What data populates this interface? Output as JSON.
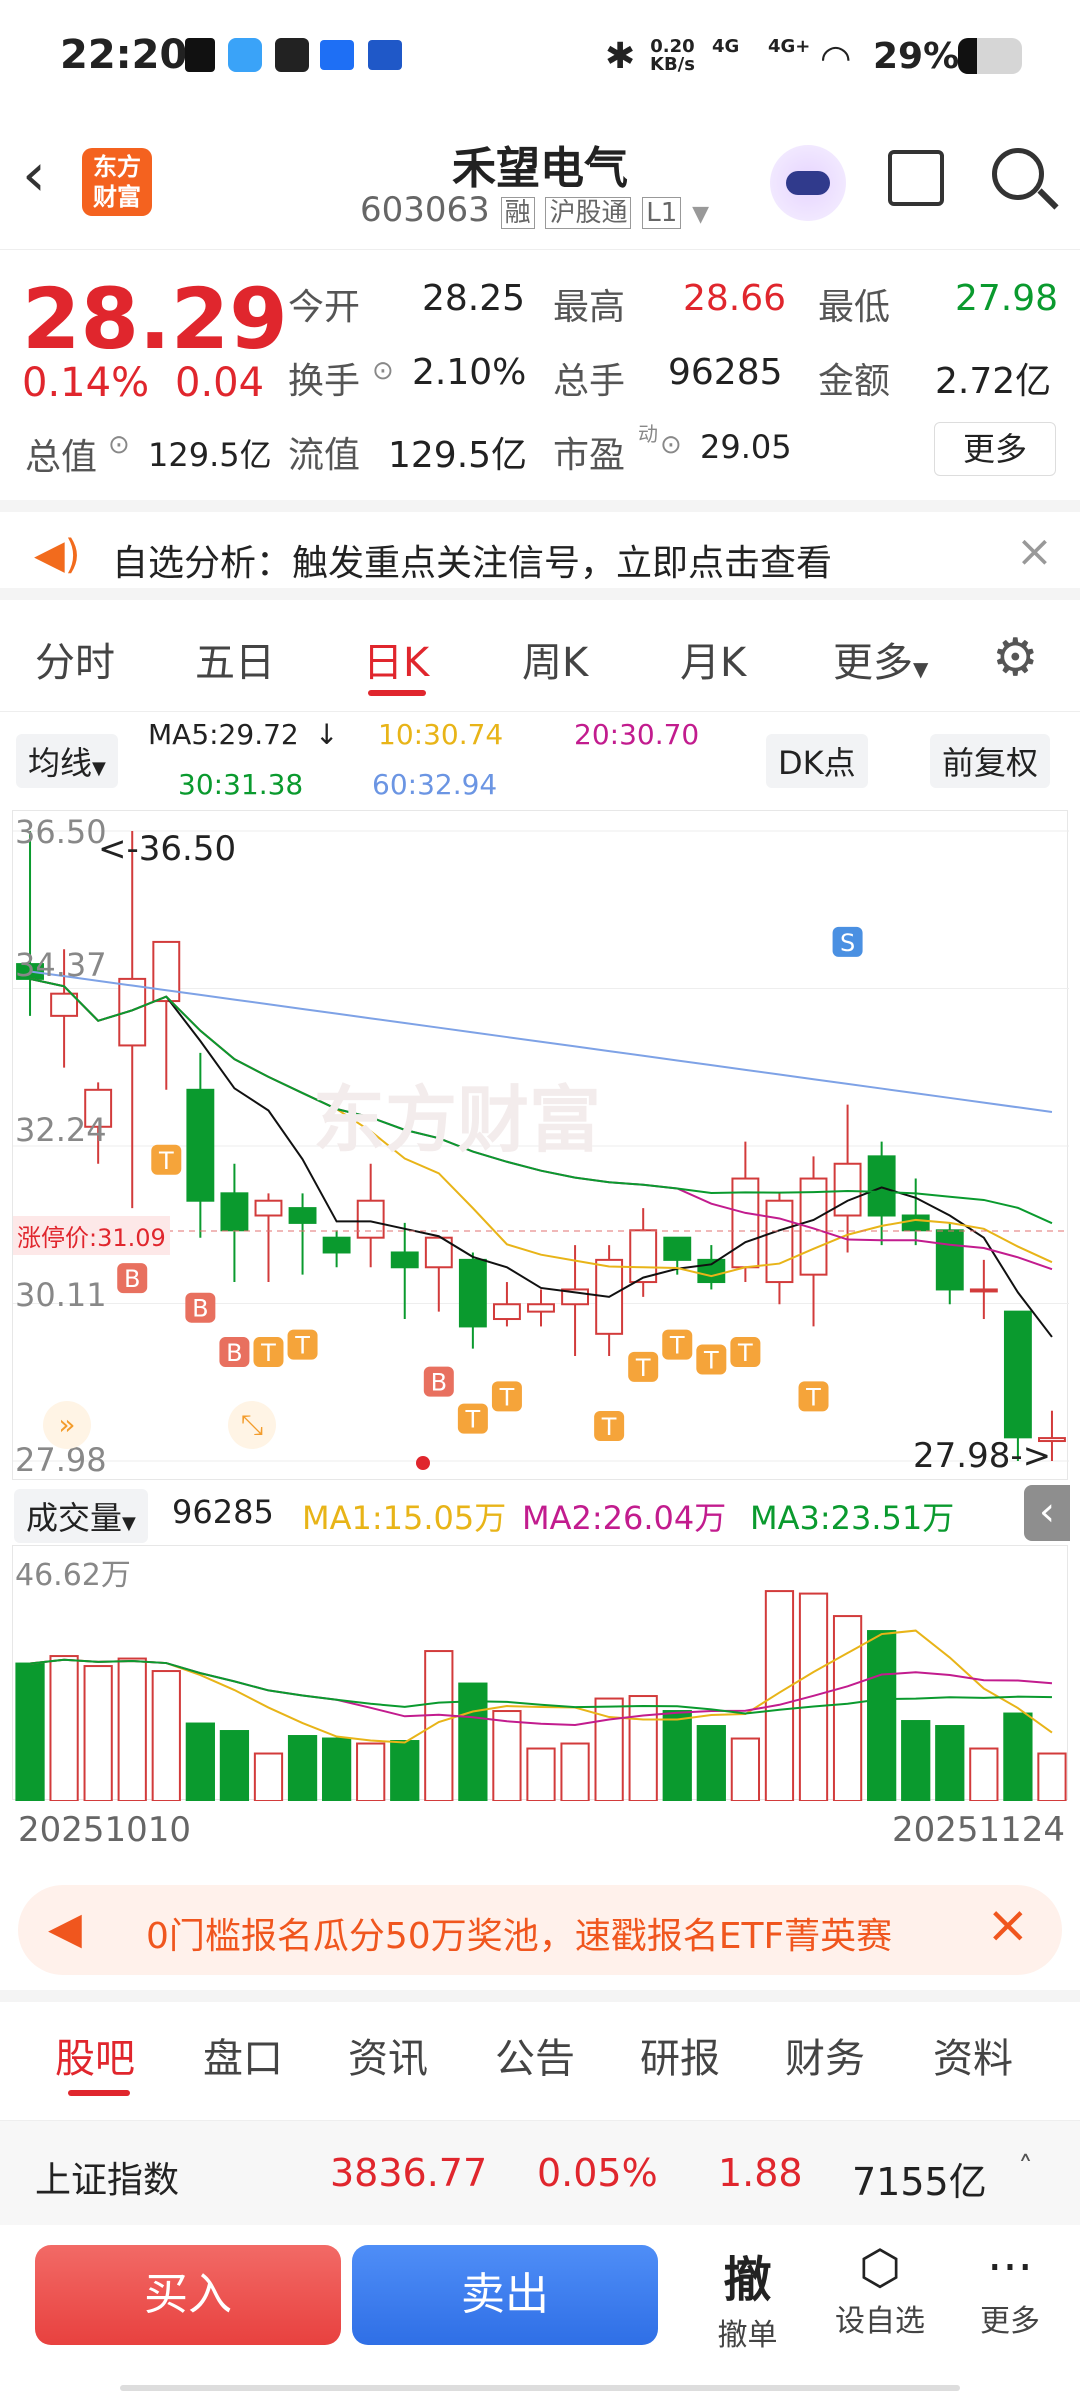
{
  "status": {
    "time": "22:20",
    "net_speed": "0.20",
    "net_unit": "KB/s",
    "signal1": "4G",
    "signal2": "4G+",
    "battery": "29%"
  },
  "header": {
    "logo_line1": "东方",
    "logo_line2": "财富",
    "name": "禾望电气",
    "code": "603063",
    "tags": [
      "融",
      "沪股通",
      "L1"
    ]
  },
  "quote": {
    "price": "28.29",
    "pct": "0.14%",
    "chg": "0.04",
    "open_label": "今开",
    "open": "28.25",
    "high_label": "最高",
    "high": "28.66",
    "low_label": "最低",
    "low": "27.98",
    "turnover_label": "换手",
    "turnover": "2.10%",
    "vol_label": "总手",
    "vol": "96285",
    "amount_label": "金额",
    "amount": "2.72亿",
    "mcap_label": "总值",
    "mcap": "129.5亿",
    "float_label": "流值",
    "float": "129.5亿",
    "pe_label": "市盈",
    "pe_sup": "动",
    "pe": "29.05",
    "more": "更多"
  },
  "notice": {
    "text": "自选分析：触发重点关注信号，立即点击查看"
  },
  "tabs": [
    "分时",
    "五日",
    "日K",
    "周K",
    "月K",
    "更多"
  ],
  "ma_bar": {
    "label": "均线",
    "ma5": "MA5:29.72",
    "ma10": "10:30.74",
    "ma20": "20:30.70",
    "ma30": "30:31.38",
    "ma60": "60:32.94",
    "dk": "DK点",
    "adj": "前复权"
  },
  "kchart": {
    "y_labels": [
      "36.50",
      "34.37",
      "32.24",
      "30.11",
      "27.98"
    ],
    "max_marker": "<-36.50",
    "min_marker": "27.98->",
    "limit_label": "涨停价:31.09",
    "marker_S": "S",
    "marker_B": "B",
    "marker_T": "T",
    "watermark": "东方财富"
  },
  "vol_bar": {
    "label": "成交量",
    "value": "96285",
    "ma1": "MA1:15.05万",
    "ma2": "MA2:26.04万",
    "ma3": "MA3:23.51万",
    "y_max": "46.62万"
  },
  "dates": {
    "start": "20251010",
    "end": "20251124"
  },
  "promo": {
    "text": "0门槛报名瓜分50万奖池，速戳报名ETF菁英赛"
  },
  "bottom_tabs": [
    "股吧",
    "盘口",
    "资讯",
    "公告",
    "研报",
    "财务",
    "资料"
  ],
  "index": {
    "name": "上证指数",
    "value": "3836.77",
    "pct": "0.05%",
    "chg": "1.88",
    "amount": "7155亿"
  },
  "actions": {
    "buy": "买入",
    "sell": "卖出",
    "cancel_icon": "撤",
    "cancel": "撤单",
    "fav": "设自选",
    "more": "更多"
  },
  "chart_data": {
    "type": "candlestick",
    "x_range": [
      "20251010",
      "20251124"
    ],
    "ylim": [
      27.98,
      36.5
    ],
    "candles": [
      {
        "o": 34.7,
        "h": 36.5,
        "l": 34.0,
        "c": 34.5
      },
      {
        "o": 34.0,
        "h": 34.9,
        "l": 33.3,
        "c": 34.3
      },
      {
        "o": 32.5,
        "h": 33.1,
        "l": 32.0,
        "c": 33.0
      },
      {
        "o": 33.6,
        "h": 36.5,
        "l": 31.4,
        "c": 34.5
      },
      {
        "o": 34.2,
        "h": 34.8,
        "l": 33.0,
        "c": 35.0
      },
      {
        "o": 33.0,
        "h": 33.5,
        "l": 31.0,
        "c": 31.5
      },
      {
        "o": 31.6,
        "h": 32.0,
        "l": 30.4,
        "c": 31.1
      },
      {
        "o": 31.3,
        "h": 31.6,
        "l": 30.4,
        "c": 31.5
      },
      {
        "o": 31.4,
        "h": 31.6,
        "l": 30.5,
        "c": 31.2
      },
      {
        "o": 31.0,
        "h": 31.1,
        "l": 30.6,
        "c": 30.8
      },
      {
        "o": 31.0,
        "h": 32.0,
        "l": 30.6,
        "c": 31.5
      },
      {
        "o": 30.8,
        "h": 31.2,
        "l": 29.9,
        "c": 30.6
      },
      {
        "o": 30.6,
        "h": 31.0,
        "l": 30.0,
        "c": 31.0
      },
      {
        "o": 30.7,
        "h": 30.8,
        "l": 29.5,
        "c": 29.8
      },
      {
        "o": 29.9,
        "h": 30.4,
        "l": 29.8,
        "c": 30.1
      },
      {
        "o": 30.0,
        "h": 30.3,
        "l": 29.8,
        "c": 30.1
      },
      {
        "o": 30.1,
        "h": 30.9,
        "l": 29.4,
        "c": 30.3
      },
      {
        "o": 29.7,
        "h": 30.9,
        "l": 29.4,
        "c": 30.7
      },
      {
        "o": 30.4,
        "h": 31.4,
        "l": 30.2,
        "c": 31.1
      },
      {
        "o": 31.0,
        "h": 31.0,
        "l": 30.5,
        "c": 30.7
      },
      {
        "o": 30.7,
        "h": 30.9,
        "l": 30.3,
        "c": 30.4
      },
      {
        "o": 30.6,
        "h": 32.3,
        "l": 30.4,
        "c": 31.8
      },
      {
        "o": 30.4,
        "h": 31.6,
        "l": 30.1,
        "c": 31.5
      },
      {
        "o": 30.5,
        "h": 32.1,
        "l": 29.8,
        "c": 31.8
      },
      {
        "o": 31.3,
        "h": 32.8,
        "l": 30.8,
        "c": 32.0
      },
      {
        "o": 32.1,
        "h": 32.3,
        "l": 30.9,
        "c": 31.3
      },
      {
        "o": 31.3,
        "h": 31.8,
        "l": 30.9,
        "c": 31.1
      },
      {
        "o": 31.1,
        "h": 31.2,
        "l": 30.1,
        "c": 30.3
      },
      {
        "o": 30.3,
        "h": 30.7,
        "l": 29.9,
        "c": 30.3
      },
      {
        "o": 30.0,
        "h": 30.0,
        "l": 27.98,
        "c": 28.3
      },
      {
        "o": 28.25,
        "h": 28.66,
        "l": 27.98,
        "c": 28.29
      }
    ],
    "volume": [
      0.55,
      0.58,
      0.54,
      0.57,
      0.52,
      0.31,
      0.28,
      0.19,
      0.26,
      0.25,
      0.23,
      0.24,
      0.6,
      0.47,
      0.36,
      0.21,
      0.23,
      0.41,
      0.42,
      0.36,
      0.3,
      0.25,
      0.84,
      0.83,
      0.74,
      0.68,
      0.32,
      0.3,
      0.21,
      0.35,
      0.19
    ],
    "indicators": [
      "MA5",
      "MA10",
      "MA20",
      "MA30",
      "MA60",
      "MA1",
      "MA2",
      "MA3"
    ]
  }
}
